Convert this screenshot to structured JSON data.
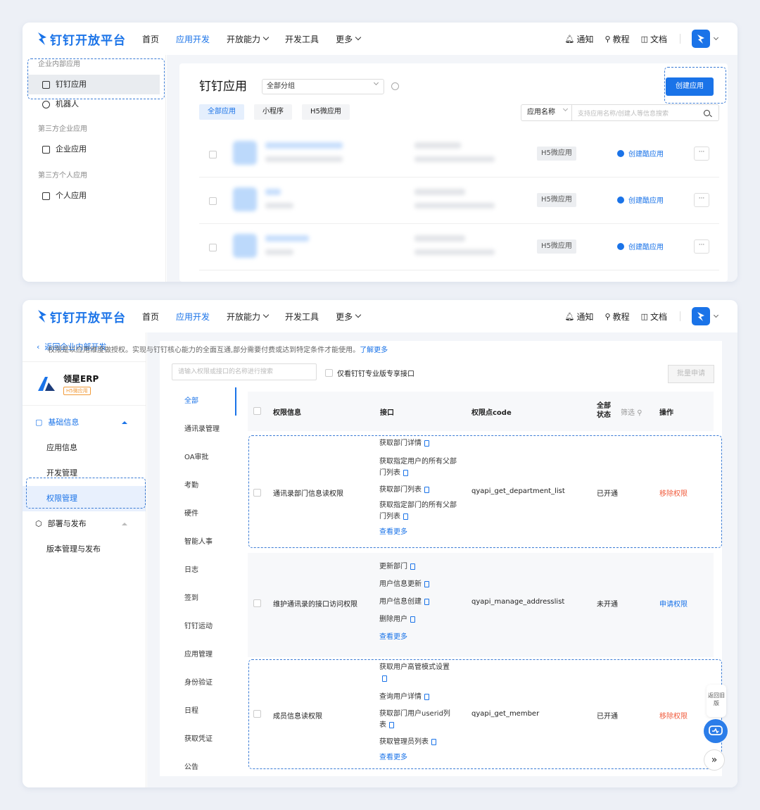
{
  "brand": {
    "name": "钉钉开放平台",
    "color": "#1a73e8"
  },
  "nav": [
    "首页",
    "应用开发",
    "开放能力",
    "开发工具",
    "更多"
  ],
  "nav_active": "应用开发",
  "right_nav": {
    "notify": "通知",
    "tutorial": "教程",
    "docs": "文档"
  },
  "panel1": {
    "sidebar": {
      "groups": [
        {
          "title": "企业内部应用",
          "items": [
            "钉钉应用",
            "机器人"
          ]
        },
        {
          "title": "第三方企业应用",
          "items": [
            "企业应用"
          ]
        },
        {
          "title": "第三方个人应用",
          "items": [
            "个人应用"
          ]
        }
      ],
      "active": "钉钉应用"
    },
    "title": "钉钉应用",
    "group_select": "全部分组",
    "create_button": "创建应用",
    "tabs": [
      "全部应用",
      "小程序",
      "H5微应用"
    ],
    "search": {
      "select": "应用名称",
      "placeholder": "支持应用名称/创建人等信息搜索"
    },
    "rows": [
      {
        "tag": "H5微应用",
        "action": "创建酷应用"
      },
      {
        "tag": "H5微应用",
        "action": "创建酷应用"
      },
      {
        "tag": "H5微应用",
        "action": "创建酷应用"
      }
    ],
    "more": "···"
  },
  "panel2": {
    "back": "返回企业内部开发",
    "app": {
      "name": "领星ERP",
      "tag": "H5微应用"
    },
    "sidebar": {
      "basic": "基础信息",
      "items": [
        "应用信息",
        "开发管理",
        "权限管理"
      ],
      "deploy": "部署与发布",
      "deploy_items": [
        "版本管理与发布"
      ],
      "active": "权限管理"
    },
    "notice": "权限是以应用维度做授权。实现与钉钉核心能力的全面互通,部分需要付费或达到特定条件才能使用。",
    "notice_link": "了解更多",
    "search_placeholder": "请输入权限或接口的名称进行搜索",
    "pro_only": "仅看钉钉专业版专享接口",
    "batch": "批量申请",
    "categories": [
      "全部",
      "通讯录管理",
      "OA审批",
      "考勤",
      "硬件",
      "智能人事",
      "日志",
      "签到",
      "钉钉运动",
      "应用管理",
      "身份验证",
      "日程",
      "获取凭证",
      "公告"
    ],
    "headers": {
      "info": "权限信息",
      "api": "接口",
      "code": "权限点code",
      "status_line1": "全部",
      "status_line2": "状态",
      "filter": "筛选",
      "op": "操作"
    },
    "rows": [
      {
        "name": "通讯录部门信息读权限",
        "apis": [
          "获取部门详情",
          "获取指定用户的所有父部门列表",
          "获取部门列表",
          "获取指定部门的所有父部门列表"
        ],
        "more": "查看更多",
        "code": "qyapi_get_department_list",
        "status": "已开通",
        "op": "移除权限"
      },
      {
        "name": "维护通讯录的接口访问权限",
        "apis": [
          "更新部门",
          "用户信息更新",
          "用户信息创建",
          "删除用户"
        ],
        "more": "查看更多",
        "code": "qyapi_manage_addresslist",
        "status": "未开通",
        "op": "申请权限"
      },
      {
        "name": "成员信息读权限",
        "apis": [
          "获取用户高管模式设置",
          "查询用户详情",
          "获取部门用户userid列表",
          "获取管理员列表"
        ],
        "more": "查看更多",
        "code": "qyapi_get_member",
        "status": "已开通",
        "op": "移除权限"
      }
    ],
    "float_back": "返回旧版"
  }
}
